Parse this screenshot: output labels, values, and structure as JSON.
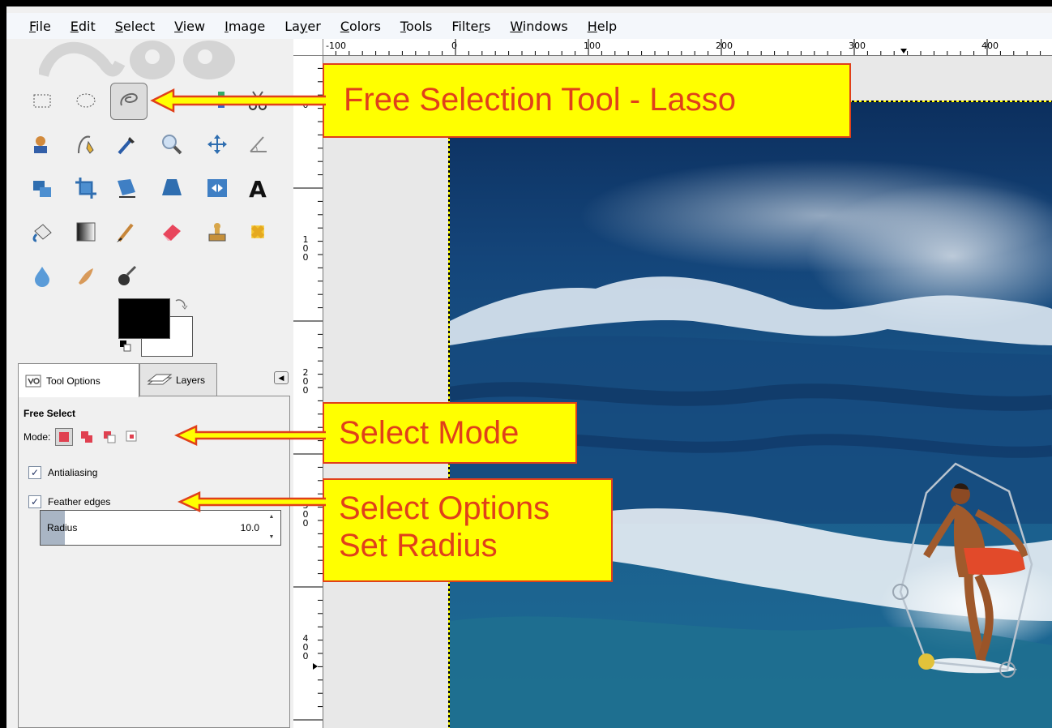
{
  "menubar": {
    "items": [
      {
        "pre": "",
        "key": "F",
        "post": "ile"
      },
      {
        "pre": "",
        "key": "E",
        "post": "dit"
      },
      {
        "pre": "",
        "key": "S",
        "post": "elect"
      },
      {
        "pre": "",
        "key": "V",
        "post": "iew"
      },
      {
        "pre": "",
        "key": "I",
        "post": "mage"
      },
      {
        "pre": "La",
        "key": "y",
        "post": "er"
      },
      {
        "pre": "",
        "key": "C",
        "post": "olors"
      },
      {
        "pre": "",
        "key": "T",
        "post": "ools"
      },
      {
        "pre": "Filte",
        "key": "r",
        "post": "s"
      },
      {
        "pre": "",
        "key": "W",
        "post": "indows"
      },
      {
        "pre": "",
        "key": "H",
        "post": "elp"
      }
    ]
  },
  "toolbox": {
    "active_tool": "free-select-tool",
    "foreground_color": "#000000",
    "background_color": "#ffffff"
  },
  "dock": {
    "tabs": {
      "tool_options": "Tool Options",
      "layers": "Layers"
    },
    "panel_title": "Free Select",
    "mode_label": "Mode:",
    "antialiasing_label": "Antialiasing",
    "antialiasing_checked": true,
    "feather_label": "Feather edges",
    "feather_checked": true,
    "radius_label": "Radius",
    "radius_value": "10.0"
  },
  "rulers": {
    "top_labels": [
      "-100",
      "0",
      "100",
      "200",
      "300",
      "400"
    ],
    "left_labels": [
      "0",
      "1\n0\n0",
      "2\n0\n0",
      "3\n0\n0",
      "4\n0\n0"
    ]
  },
  "callouts": {
    "lasso": "Free Selection Tool - Lasso",
    "mode": "Select Mode",
    "options_line1": "Select Options",
    "options_line2": "Set Radius"
  },
  "colors": {
    "callout_bg": "#ffff00",
    "callout_text": "#e0401a",
    "ocean_dark": "#0f3a66",
    "ocean_mid": "#1d5f8e"
  }
}
